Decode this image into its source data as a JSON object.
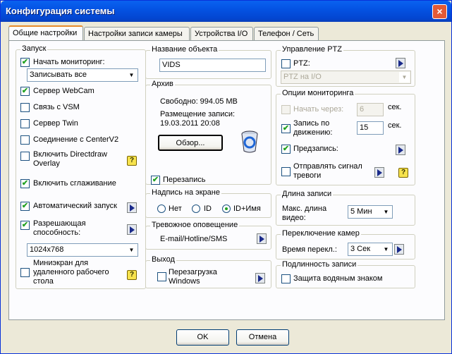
{
  "window": {
    "title": "Конфигурация системы",
    "close_label": "×"
  },
  "tabs": [
    {
      "label": "Общие настройки"
    },
    {
      "label": "Настройки записи камеры"
    },
    {
      "label": "Устройства I/O"
    },
    {
      "label": "Телефон / Сеть"
    }
  ],
  "launch": {
    "group_label": "Запуск",
    "start_monitoring": {
      "label": "Начать мониторинг:",
      "checked": true
    },
    "record_combo": "Записывать все",
    "webcam_server": {
      "label": "Сервер WebCam",
      "checked": true
    },
    "vsm_link": {
      "label": "Связь с VSM",
      "checked": false
    },
    "twin_server": {
      "label": "Сервер Twin",
      "checked": false
    },
    "centerv2": {
      "label": "Соединение с CenterV2",
      "checked": false
    },
    "directdraw": {
      "label1": "Включить Directdraw",
      "label2": "Overlay",
      "checked": false
    },
    "smoothing": {
      "label": "Включить сглаживание",
      "checked": true
    },
    "autostart": {
      "label": "Автоматический запуск",
      "checked": true
    },
    "resolution": {
      "label1": "Разрешающая",
      "label2": "способность:",
      "checked": true
    },
    "resolution_combo": "1024x768",
    "miniscreen": {
      "label1": "Миниэкран для",
      "label2": "удаленного рабочего",
      "label3": "стола",
      "checked": false
    }
  },
  "object": {
    "group_label": "Название объекта",
    "value": "VIDS"
  },
  "archive": {
    "group_label": "Архив",
    "free": "Свободно: 994.05 MB",
    "placement1": "Размещение записи:",
    "placement2": "19.03.2011 20:08",
    "browse_label": "Обзор...",
    "overwrite": {
      "label": "Перезапись",
      "checked": true
    }
  },
  "screen_label": {
    "group_label": "Надпись на экране",
    "options": [
      "Нет",
      "ID",
      "ID+Имя"
    ],
    "selected": 2
  },
  "alarm": {
    "group_label": "Тревожное оповещение",
    "label": "E-mail/Hotline/SMS"
  },
  "exit": {
    "group_label": "Выход",
    "label1": "Перезагрузка",
    "label2": "Windows",
    "checked": false
  },
  "ptz": {
    "group_label": "Управление PTZ",
    "ptz_check": {
      "label": "PTZ:",
      "checked": false
    },
    "combo": "PTZ на I/O"
  },
  "monitor_opts": {
    "group_label": "Опции мониторинга",
    "start_after": {
      "label": "Начать через:",
      "checked": false,
      "value": "6",
      "unit": "сек."
    },
    "motion": {
      "label1": "Запись по",
      "label2": "движению:",
      "checked": true,
      "value": "15",
      "unit": "сек."
    },
    "prerecord": {
      "label": "Предзапись:",
      "checked": true
    },
    "alarm_signal": {
      "label1": "Отправлять сигнал",
      "label2": "тревоги",
      "checked": false
    }
  },
  "record_length": {
    "group_label": "Длина записи",
    "label1": "Макс. длина",
    "label2": "видео:",
    "combo": "5 Мин"
  },
  "switch": {
    "group_label": "Переключение камер",
    "label": "Время перекл.:",
    "combo": "3 Сек"
  },
  "authenticity": {
    "group_label": "Подлинность записи",
    "watermark": {
      "label": "Защита водяным знаком",
      "checked": false
    }
  },
  "footer": {
    "ok": "OK",
    "cancel": "Отмена"
  },
  "colors": {
    "title_bar": "#0453e3",
    "dialog_bg": "#ece9d8",
    "check_mark": "#21a121",
    "tab_highlight": "#e68b2c"
  }
}
